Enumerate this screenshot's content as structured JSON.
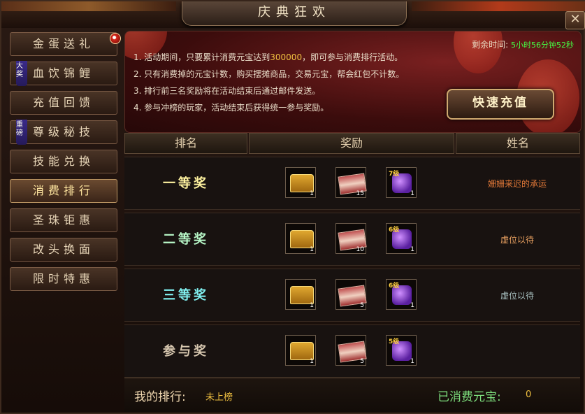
{
  "window": {
    "title": "庆典狂欢",
    "close_label": "✕"
  },
  "sidebar": {
    "items": [
      {
        "label": "金蛋送礼",
        "active": false,
        "tag": "",
        "dot": true
      },
      {
        "label": "血饮锦鲤",
        "active": false,
        "tag": "大奖",
        "dot": false
      },
      {
        "label": "充值回馈",
        "active": false,
        "tag": "",
        "dot": false
      },
      {
        "label": "尊级秘技",
        "active": false,
        "tag": "重磅",
        "dot": false
      },
      {
        "label": "技能兑换",
        "active": false,
        "tag": "",
        "dot": false
      },
      {
        "label": "消费排行",
        "active": true,
        "tag": "",
        "dot": false
      },
      {
        "label": "圣珠钜惠",
        "active": false,
        "tag": "",
        "dot": false
      },
      {
        "label": "改头换面",
        "active": false,
        "tag": "",
        "dot": false
      },
      {
        "label": "限时特惠",
        "active": false,
        "tag": "",
        "dot": false
      }
    ]
  },
  "banner": {
    "rules": [
      {
        "prefix": "1. 活动期间，只要累计消费元宝达到",
        "highlight": "300000",
        "suffix": "，即可参与消费排行活动。"
      },
      {
        "prefix": "2. 只有消费掉的元宝计数，购买摆摊商品，交易元宝，帮会红包不计数。",
        "highlight": "",
        "suffix": ""
      },
      {
        "prefix": "3. 排行前三名奖励将在活动结束后通过邮件发送。",
        "highlight": "",
        "suffix": ""
      },
      {
        "prefix": "4. 参与冲榜的玩家，活动结束后获得统一参与奖励。",
        "highlight": "",
        "suffix": ""
      }
    ],
    "timer_label": "剩余时间:",
    "timer_value": "5小时56分钟52秒",
    "recharge_label": "快速充值"
  },
  "table": {
    "headers": [
      "排名",
      "奖励",
      "姓名"
    ],
    "rows": [
      {
        "rank": "一等奖",
        "rank_color": "#fff3a0",
        "name": "姗姗来迟的承运",
        "name_color": "#e07838",
        "rewards": [
          {
            "icon": "treasure-chest-icon",
            "count": "1"
          },
          {
            "icon": "scroll-icon",
            "count": "15"
          },
          {
            "icon": "gem-bag-icon",
            "level": "7级",
            "count": "1"
          }
        ]
      },
      {
        "rank": "二等奖",
        "rank_color": "#b8f8c8",
        "name": "虚位以待",
        "name_color": "#e8a060",
        "rewards": [
          {
            "icon": "treasure-chest-icon",
            "count": "1"
          },
          {
            "icon": "scroll-icon",
            "count": "10"
          },
          {
            "icon": "gem-bag-icon",
            "level": "6级",
            "count": "1"
          }
        ]
      },
      {
        "rank": "三等奖",
        "rank_color": "#80f0f0",
        "name": "虚位以待",
        "name_color": "#a8c0c0",
        "rewards": [
          {
            "icon": "treasure-chest-icon",
            "count": "1"
          },
          {
            "icon": "scroll-icon",
            "count": "5"
          },
          {
            "icon": "gem-bag-icon",
            "level": "6级",
            "count": "1"
          }
        ]
      },
      {
        "rank": "参与奖",
        "rank_color": "#d8c8b0",
        "name": "",
        "name_color": "#d8c8b0",
        "rewards": [
          {
            "icon": "treasure-chest-icon",
            "count": "1"
          },
          {
            "icon": "scroll-icon",
            "count": "5"
          },
          {
            "icon": "gem-bag-icon",
            "level": "5级",
            "count": "1"
          }
        ]
      }
    ]
  },
  "footer": {
    "my_rank_label": "我的排行:",
    "my_rank_value": "未上榜",
    "consumed_label": "已消费元宝:",
    "consumed_value": "0"
  },
  "colors": {
    "accent_gold": "#f0c040",
    "timer_green": "#44ff44",
    "footer_label": "#f0d8b0",
    "consumed_label": "#7ee07e"
  }
}
